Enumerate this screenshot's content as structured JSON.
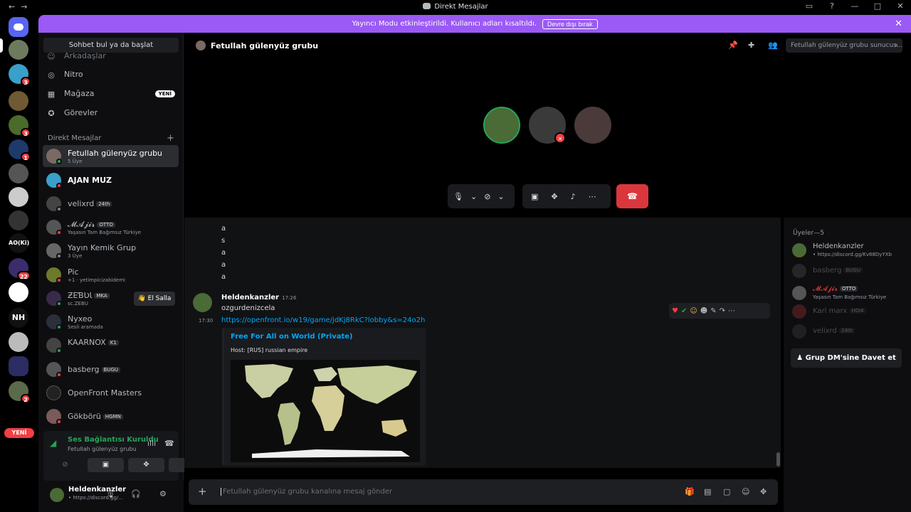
{
  "window": {
    "title": "Direkt Mesajlar",
    "nav_back": "←",
    "nav_forward": "→"
  },
  "banner": {
    "text": "Yayıncı Modu etkinleştirildi. Kullanıcı adları kısaltıldı.",
    "button": "Devre dışı bırak",
    "close": "✕"
  },
  "servers": [
    {
      "label": "",
      "badge": ""
    },
    {
      "label": "",
      "badge": "3"
    },
    {
      "label": "",
      "badge": ""
    },
    {
      "label": "",
      "badge": "3"
    },
    {
      "label": "",
      "badge": "1"
    },
    {
      "label": "AO(Ki)",
      "badge": ""
    },
    {
      "label": "NH",
      "badge": ""
    },
    {
      "label": "",
      "badge": "22"
    },
    {
      "label": "",
      "badge": "2"
    }
  ],
  "server_new_badge": "YENİ",
  "dm_sidebar": {
    "search": "Sohbet bul ya da başlat",
    "nav": [
      {
        "label": "Arkadaşlar",
        "icon": "friends-icon"
      },
      {
        "label": "Nitro",
        "icon": "nitro-icon"
      },
      {
        "label": "Mağaza",
        "icon": "store-icon",
        "badge": "YENİ"
      },
      {
        "label": "Görevler",
        "icon": "quests-icon"
      }
    ],
    "section_title": "Direkt Mesajlar",
    "section_add": "+",
    "dms": [
      {
        "name": "Fetullah gülenyüz grubu",
        "sub": "5 Üye",
        "tag": ""
      },
      {
        "name": "AJAN MUZ",
        "sub": "",
        "tag": ""
      },
      {
        "name": "velixrd",
        "sub": "",
        "tag": "24th"
      },
      {
        "name": "𝓜𝓐𝓳𝓲𝓻",
        "sub": "Yaşasın Tam Bağımsız Türkiye",
        "tag": "OTTO"
      },
      {
        "name": "Yayın Kemik Grup",
        "sub": "3 Üye",
        "tag": ""
      },
      {
        "name": "Pic",
        "sub": "+1 · yetimpicizabidemi",
        "tag": ""
      },
      {
        "name": "ƵЕƁƲƖ",
        "sub": "sc.ZEBU",
        "tag": "MKA"
      },
      {
        "name": "Nyxeo",
        "sub": "Sesli aramada",
        "tag": ""
      },
      {
        "name": "KAARNOX",
        "sub": "",
        "tag": "K1"
      },
      {
        "name": "basberg",
        "sub": "",
        "tag": "BUGU"
      },
      {
        "name": "OpenFront Masters",
        "sub": "",
        "tag": ""
      },
      {
        "name": "Gökbörü",
        "sub": "",
        "tag": "HGMN"
      }
    ],
    "wave_button": "👋 El Salla"
  },
  "voice_panel": {
    "status": "Ses Bağlantısı Kuruldu",
    "channel": "Fetullah gülenyüz grubu"
  },
  "user_panel": {
    "name": "Heldenkanzler",
    "status": "• https://discord.gg/..."
  },
  "channel": {
    "name": "Fetullah gülenyüz grubu",
    "search_placeholder": "Fetullah gülenyüz grubu sunucus..."
  },
  "chat": {
    "earlier_lines": [
      "a",
      "s",
      "a",
      "a",
      "a"
    ],
    "message": {
      "author": "Heldenkanzler",
      "time": "17:26",
      "text": "ozgurdenizcela",
      "time2": "17:30",
      "link": "https://openfront.io/w19/game/jdKj8RkC?lobby&s=24o2h"
    },
    "embed": {
      "title": "Free For All on World (Private)",
      "description": "Host: [RUS] russian empire"
    },
    "composer_placeholder": "Fetullah gülenyüz grubu kanalına mesaj gönder",
    "composer_plus": "+"
  },
  "members": {
    "header": "Üyeler—5",
    "list": [
      {
        "name": "Heldenkanzler",
        "sub": "• https://discord.gg/Kv88DyYXb",
        "tag": ""
      },
      {
        "name": "basberg",
        "sub": "",
        "tag": "BUGU"
      },
      {
        "name": "𝓜𝓐𝓳𝓲𝓻",
        "sub": "Yaşasın Tam Bağımsız Türkiye",
        "tag": "OTTO"
      },
      {
        "name": "Karl marx",
        "sub": "",
        "tag": "HOI4"
      },
      {
        "name": "velixrd",
        "sub": "",
        "tag": "24th"
      }
    ],
    "invite_button": "Grup DM'sine Davet et"
  },
  "colors": {
    "accent": "#5865f2",
    "banner": "#9b59f5",
    "online": "#23a55a",
    "danger": "#da373c",
    "link": "#00a8fc"
  }
}
